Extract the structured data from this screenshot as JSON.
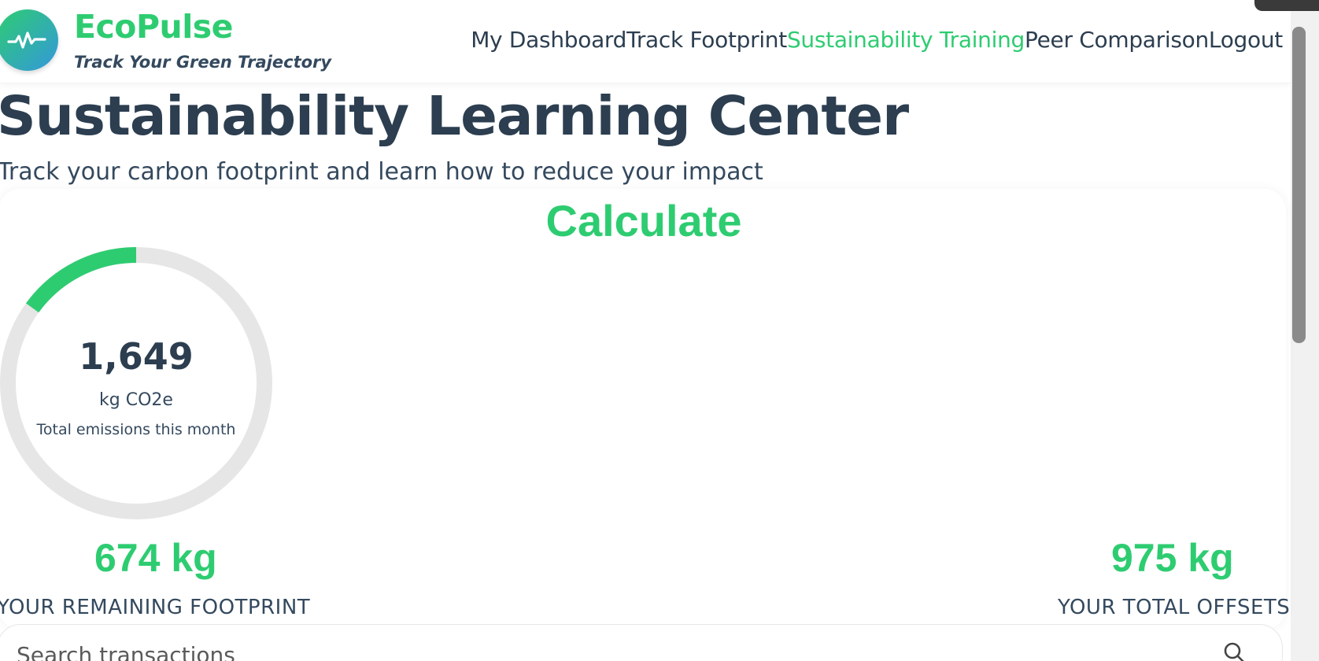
{
  "header": {
    "brand": "EcoPulse",
    "tagline": "Track Your Green Trajectory",
    "logo_icon": "pulse-wave-icon",
    "nav": [
      {
        "label": "My Dashboard",
        "active": false
      },
      {
        "label": "Track Footprint",
        "active": false
      },
      {
        "label": "Sustainability Training",
        "active": true
      },
      {
        "label": "Peer Comparison",
        "active": false
      },
      {
        "label": "Logout",
        "active": false
      }
    ]
  },
  "page": {
    "title": "Sustainability Learning Center",
    "subtitle": "Track your carbon footprint and learn how to reduce your impact"
  },
  "calculator": {
    "title": "Calculate",
    "gauge": {
      "value": "1,649",
      "unit": "kg CO2e",
      "caption": "Total emissions this month",
      "progress_fraction": 0.15
    },
    "remaining": {
      "value": "674 kg",
      "label": "YOUR REMAINING FOOTPRINT"
    },
    "offsets": {
      "value": "975 kg",
      "label": "YOUR TOTAL OFFSETS"
    }
  },
  "search": {
    "placeholder": "Search transactions"
  },
  "colors": {
    "accent": "#2ecc71",
    "text_dark": "#2c3e50",
    "gauge_track": "#e6e6e6",
    "logo_gradient_end": "#3498db"
  }
}
